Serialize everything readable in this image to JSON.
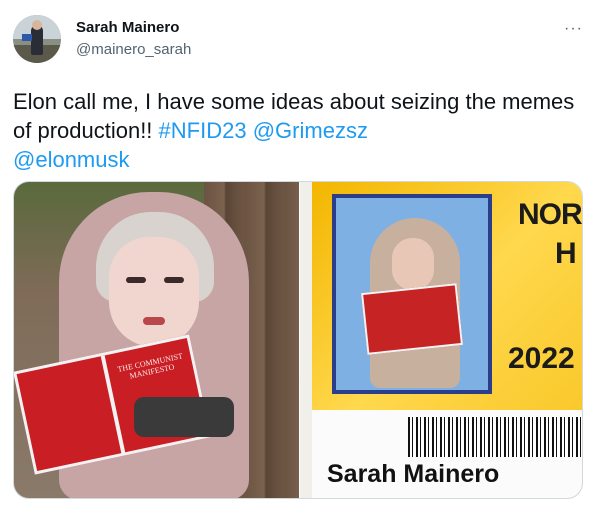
{
  "tweet": {
    "display_name": "Sarah Mainero",
    "handle": "@mainero_sarah",
    "more_icon": "more-icon",
    "text": {
      "plain": "Elon call me, I have some ideas about  seizing the memes of production!! ",
      "hashtag": "#NFID23",
      "mention1": "@Grimezsz",
      "mention2": "@elonmusk"
    }
  },
  "media": {
    "left_photo": {
      "book_cover_text": "THE COMMUNIST MANIFESTO"
    },
    "right_photo": {
      "card_top_text": "NOR",
      "card_mid_text": "H",
      "card_year": "2022",
      "card_name": "Sarah Mainero"
    }
  },
  "colors": {
    "link": "#1d9bf0",
    "text": "#0f1419",
    "secondary": "#536471"
  }
}
